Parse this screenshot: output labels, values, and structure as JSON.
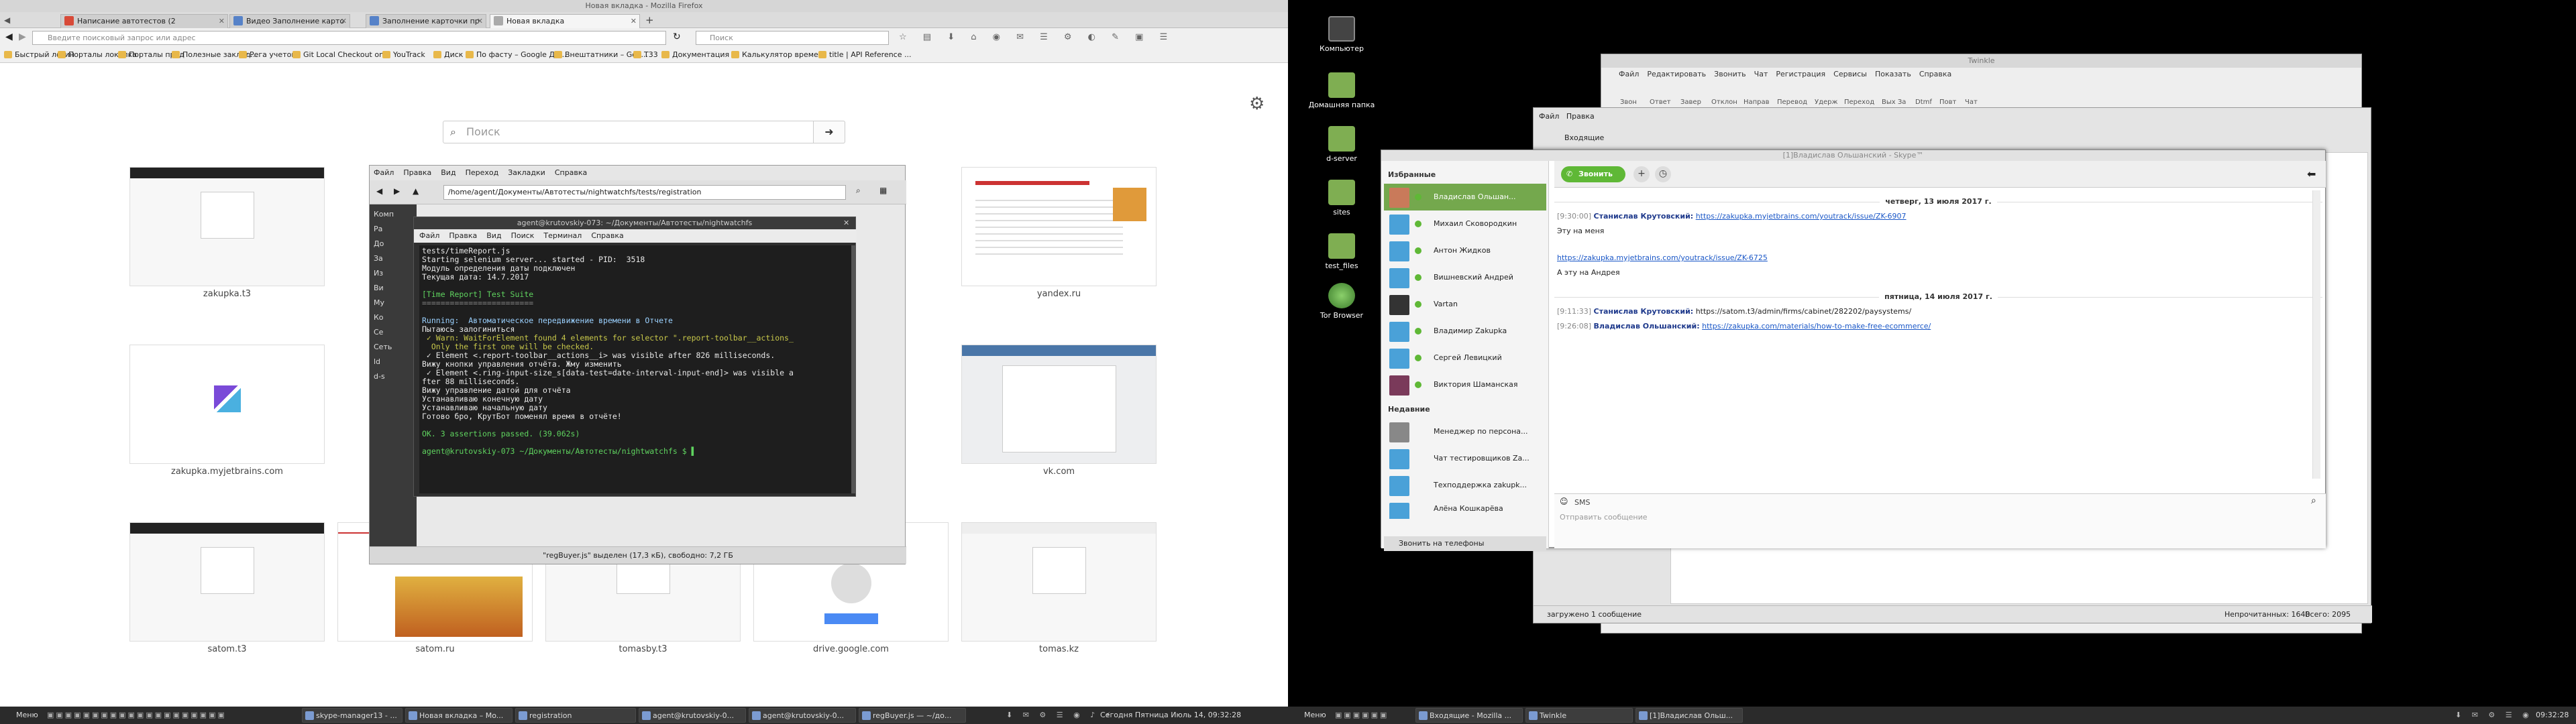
{
  "firefox": {
    "window_title": "Новая вкладка - Mozilla Firefox",
    "tabs": [
      {
        "label": "Написание автотестов (2",
        "color": "#d84a38"
      },
      {
        "label": "Видео Заполнение карто",
        "color": "#5682c8"
      },
      {
        "label": "Заполнение карточки пр",
        "color": "#5682c8"
      },
      {
        "label": "Новая вкладка",
        "color": "#aaaaaa"
      }
    ],
    "url_placeholder": "Введите поисковый запрос или адрес",
    "search_placeholder": "Поиск",
    "bookmarks": [
      "Быстрый логин",
      "Порталы локалка",
      "Порталы прод",
      "Полезные заклад...",
      "Рега учеток",
      "Git Local Checkout on...",
      "YouTrack",
      "Диск",
      "По фасту – Google Ди...",
      "Внештатники – Goo...",
      "Т33",
      "Документация",
      "Калькулятор време...",
      "title | API Reference ..."
    ],
    "newtab_search_placeholder": "Поиск",
    "tiles": [
      {
        "caption": "zakupka.t3"
      },
      {
        "caption": ""
      },
      {
        "caption": ""
      },
      {
        "caption": ""
      },
      {
        "caption": "yandex.ru"
      },
      {
        "caption": "zakupka.myjetbrains.com"
      },
      {
        "caption": ""
      },
      {
        "caption": ""
      },
      {
        "caption": ""
      },
      {
        "caption": "vk.com"
      },
      {
        "caption": "satom.t3"
      },
      {
        "caption": "satom.ru"
      },
      {
        "caption": "tomasby.t3"
      },
      {
        "caption": "drive.google.com"
      },
      {
        "caption": "tomas.kz"
      }
    ]
  },
  "nautilus": {
    "menu": [
      "Файл",
      "Правка",
      "Вид",
      "Переход",
      "Закладки",
      "Справка"
    ],
    "path": "/home/agent/Документы/Автотесты/nightwatchfs/tests/registration",
    "sidebar": [
      "Комп",
      "Ра",
      "До",
      "За",
      "Из",
      "Ви",
      "Му",
      "Ко",
      "Се",
      "Сеть",
      "ld",
      "d-s"
    ],
    "status": "\"regBuyer.js\" выделен (17,3 кБ), свободно: 7,2 ГБ"
  },
  "terminal": {
    "title": "agent@krutovskiy-073: ~/Документы/Автотесты/nightwatchfs",
    "menu": [
      "Файл",
      "Правка",
      "Вид",
      "Поиск",
      "Терминал",
      "Справка"
    ],
    "lines": [
      {
        "text": "tests/timeReport.js",
        "cls": ""
      },
      {
        "text": "Starting selenium server... started - PID:  3518",
        "cls": ""
      },
      {
        "text": "Модуль определения даты подключен",
        "cls": ""
      },
      {
        "text": "Текущая дата: 14.7.2017",
        "cls": ""
      },
      {
        "text": "",
        "cls": ""
      },
      {
        "text": "[Time Report] Test Suite",
        "cls": "t-g"
      },
      {
        "text": "========================",
        "cls": "t-gray"
      },
      {
        "text": "",
        "cls": ""
      },
      {
        "text": "Running:  Автоматическое передвижение времени в Отчете",
        "cls": "t-p"
      },
      {
        "text": "Пытаюсь залогиниться",
        "cls": ""
      },
      {
        "text": " ✓ Warn: WaitForElement found 4 elements for selector \".report-toolbar__actions_",
        "cls": "t-y"
      },
      {
        "text": "  Only the first one will be checked.",
        "cls": "t-y"
      },
      {
        "text": " ✓ Element <.report-toolbar__actions__i> was visible after 826 milliseconds.",
        "cls": ""
      },
      {
        "text": "Вижу кнопки управления отчёта. Жму изменить",
        "cls": ""
      },
      {
        "text": " ✓ Element <.ring-input-size_s[data-test=date-interval-input-end]> was visible a",
        "cls": ""
      },
      {
        "text": "fter 88 milliseconds.",
        "cls": ""
      },
      {
        "text": "Вижу управление датой для отчёта",
        "cls": ""
      },
      {
        "text": "Устанавливаю конечную дату",
        "cls": ""
      },
      {
        "text": "Устанавливаю начальную дату",
        "cls": ""
      },
      {
        "text": "Готово бро, КрутБот поменял время в отчёте!",
        "cls": ""
      },
      {
        "text": "",
        "cls": ""
      },
      {
        "text": "OK. 3 assertions passed. (39.062s)",
        "cls": "t-g"
      },
      {
        "text": "",
        "cls": ""
      },
      {
        "text": "agent@krutovskiy-073 ~/Документы/Автотесты/nightwatchfs $ ▌",
        "cls": "t-g"
      }
    ]
  },
  "desktop_icons": [
    "Компьютер",
    "Домашняя папка",
    "d-server",
    "sites",
    "test_files",
    "Tor Browser"
  ],
  "twinkle": {
    "title": "Twinkle",
    "menu": [
      "Файл",
      "Редактировать",
      "Звонить",
      "Чат",
      "Регистрация",
      "Сервисы",
      "Показать",
      "Справка"
    ],
    "toolbar": [
      "Звон",
      "Ответ",
      "Завер",
      "Отклон",
      "Направ",
      "Перевод",
      "Удерж",
      "Переход",
      "Вых За",
      "Dtmf",
      "Повт",
      "Чат"
    ]
  },
  "win2": {
    "menu": [
      "Файл",
      "Правка"
    ],
    "tab": "Входящие",
    "status_left": "загружено 1 сообщение",
    "unread": "Непрочитанных: 1640",
    "total": "Всего: 2095"
  },
  "skype": {
    "title": "[1]Владислав Ольшанский - Skype™",
    "favorites_header": "Избранные",
    "recent_header": "Недавние",
    "contacts": [
      {
        "name": "Владислав Ольшан...",
        "av": "#c97a5a",
        "selected": true
      },
      {
        "name": "Михаил Сковородкин",
        "av": "#4aa1d8",
        "selected": false
      },
      {
        "name": "Антон Жидков",
        "av": "#4aa1d8",
        "selected": false
      },
      {
        "name": "Вишневский Андрей",
        "av": "#4aa1d8",
        "selected": false
      },
      {
        "name": "Vartan",
        "av": "#333333",
        "selected": false
      },
      {
        "name": "Владимир Zakupka",
        "av": "#4aa1d8",
        "selected": false
      },
      {
        "name": "Сергей Левицкий",
        "av": "#4aa1d8",
        "selected": false
      },
      {
        "name": "Виктория Шаманская",
        "av": "#7a3a5a",
        "selected": false
      }
    ],
    "recent": [
      {
        "name": "Менеджер по персона...",
        "av": "#888888"
      },
      {
        "name": "Чат тестировщиков Za...",
        "av": "#4aa1d8"
      },
      {
        "name": "Техподдержка zakupk...",
        "av": "#4aa1d8"
      },
      {
        "name": "Алёна Кошкарёва",
        "av": "#4aa1d8"
      }
    ],
    "call_phones": "Звонить на телефоны",
    "call_button": "Звонить",
    "day1": "четверг, 13 июля 2017 г.",
    "day2": "пятница, 14 июля 2017 г.",
    "messages": [
      {
        "time": "[9:30:00]",
        "author": "Станислав Крутовский:",
        "text": "",
        "link": "https://zakupka.myjetbrains.com/youtrack/issue/ZK-6907"
      },
      {
        "time": "",
        "author": "",
        "text": "Эту на меня",
        "link": ""
      },
      {
        "time": "",
        "author": "",
        "text": "",
        "link": "https://zakupka.myjetbrains.com/youtrack/issue/ZK-6725"
      },
      {
        "time": "",
        "author": "",
        "text": "А эту на Андрея",
        "link": ""
      },
      {
        "time": "[9:11:33]",
        "author": "Станислав Крутовский:",
        "text": "https://satom.t3/admin/firms/cabinet/282202/paysystems/",
        "link": ""
      },
      {
        "time": "[9:26:08]",
        "author": "Владислав Ольшанский:",
        "text": "",
        "link": "https://zakupka.com/materials/how-to-make-free-ecommerce/"
      }
    ],
    "sms": "SMS",
    "input_placeholder": "Отправить сообщение"
  },
  "taskbar_left": {
    "menu": "Меню",
    "windows": [
      "skype-manager13 - ...",
      "Новая вкладка – Mo...",
      "registration",
      "agent@krutovskiy-0...",
      "agent@krutovskiy-0...",
      "regBuyer.js — ~/до..."
    ],
    "clock": "Сегодня Пятница Июль 14, 09:32:28"
  },
  "taskbar_right": {
    "menu": "Меню",
    "windows": [
      "Входящие - Mozilla ...",
      "Twinkle",
      "[1]Владислав Ольш..."
    ],
    "clock": "09:32:28"
  }
}
